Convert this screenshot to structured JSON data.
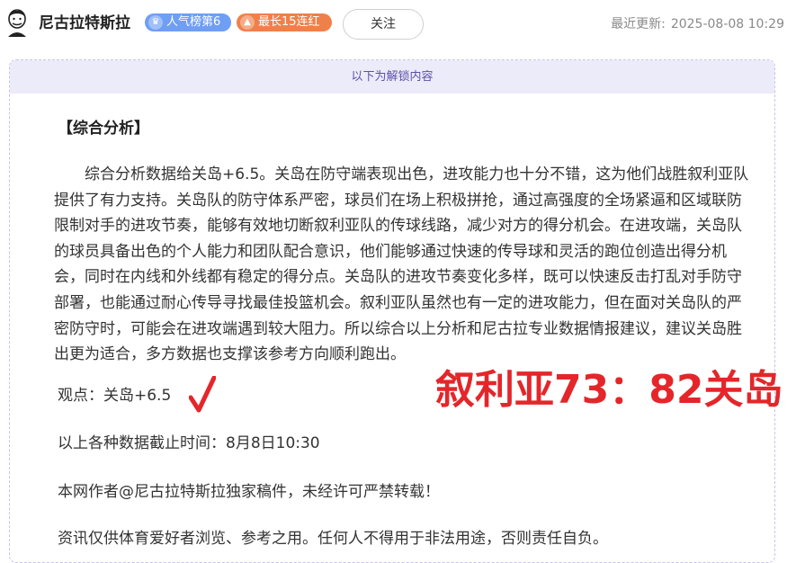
{
  "header": {
    "author_name": "尼古拉特斯拉",
    "badges": [
      {
        "icon": "crown-icon",
        "label": "人气榜第6",
        "color": "#6f9ef5"
      },
      {
        "icon": "flame-icon",
        "label": "最长15连红",
        "color": "#f0804a"
      }
    ],
    "follow_label": "关注",
    "updated_label": "最近更新:",
    "updated_time": "2025-08-08 10:29"
  },
  "content": {
    "unlock_banner": "以下为解锁内容",
    "section_title": "【综合分析】",
    "analysis": "综合分析数据给关岛+6.5。关岛在防守端表现出色，进攻能力也十分不错，这为他们战胜叙利亚队提供了有力支持。关岛队的防守体系严密，球员们在场上积极拼抢，通过高强度的全场紧逼和区域联防限制对手的进攻节奏，能够有效地切断叙利亚队的传球线路，减少对方的得分机会。在进攻端，关岛队的球员具备出色的个人能力和团队配合意识，他们能够通过快速的传导球和灵活的跑位创造出得分机会，同时在内线和外线都有稳定的得分点。关岛队的进攻节奏变化多样，既可以快速反击打乱对手防守部署，也能通过耐心传导寻找最佳投篮机会。叙利亚队虽然也有一定的进攻能力，但在面对关岛队的严密防守时，可能会在进攻端遇到较大阻力。所以综合以上分析和尼古拉专业数据情报建议，建议关岛胜出更为适合，多方数据也支撑该参考方向顺利跑出。",
    "viewpoint": "观点：关岛+6.5",
    "result_mark": "√",
    "cutoff": "以上各种数据截止时间：8月8日10:30",
    "copyright": "本网作者@尼古拉特斯拉独家稿件，未经许可严禁转载！",
    "disclaimer": "资讯仅供体育爱好者浏览、参考之用。任何人不得用于非法用途，否则责任自负。",
    "score_overlay": "叙利亚73：82关岛"
  },
  "colors": {
    "accent_purple": "#5b52a8",
    "banner_bg": "#ecebfa",
    "score_red": "#e4262a"
  }
}
